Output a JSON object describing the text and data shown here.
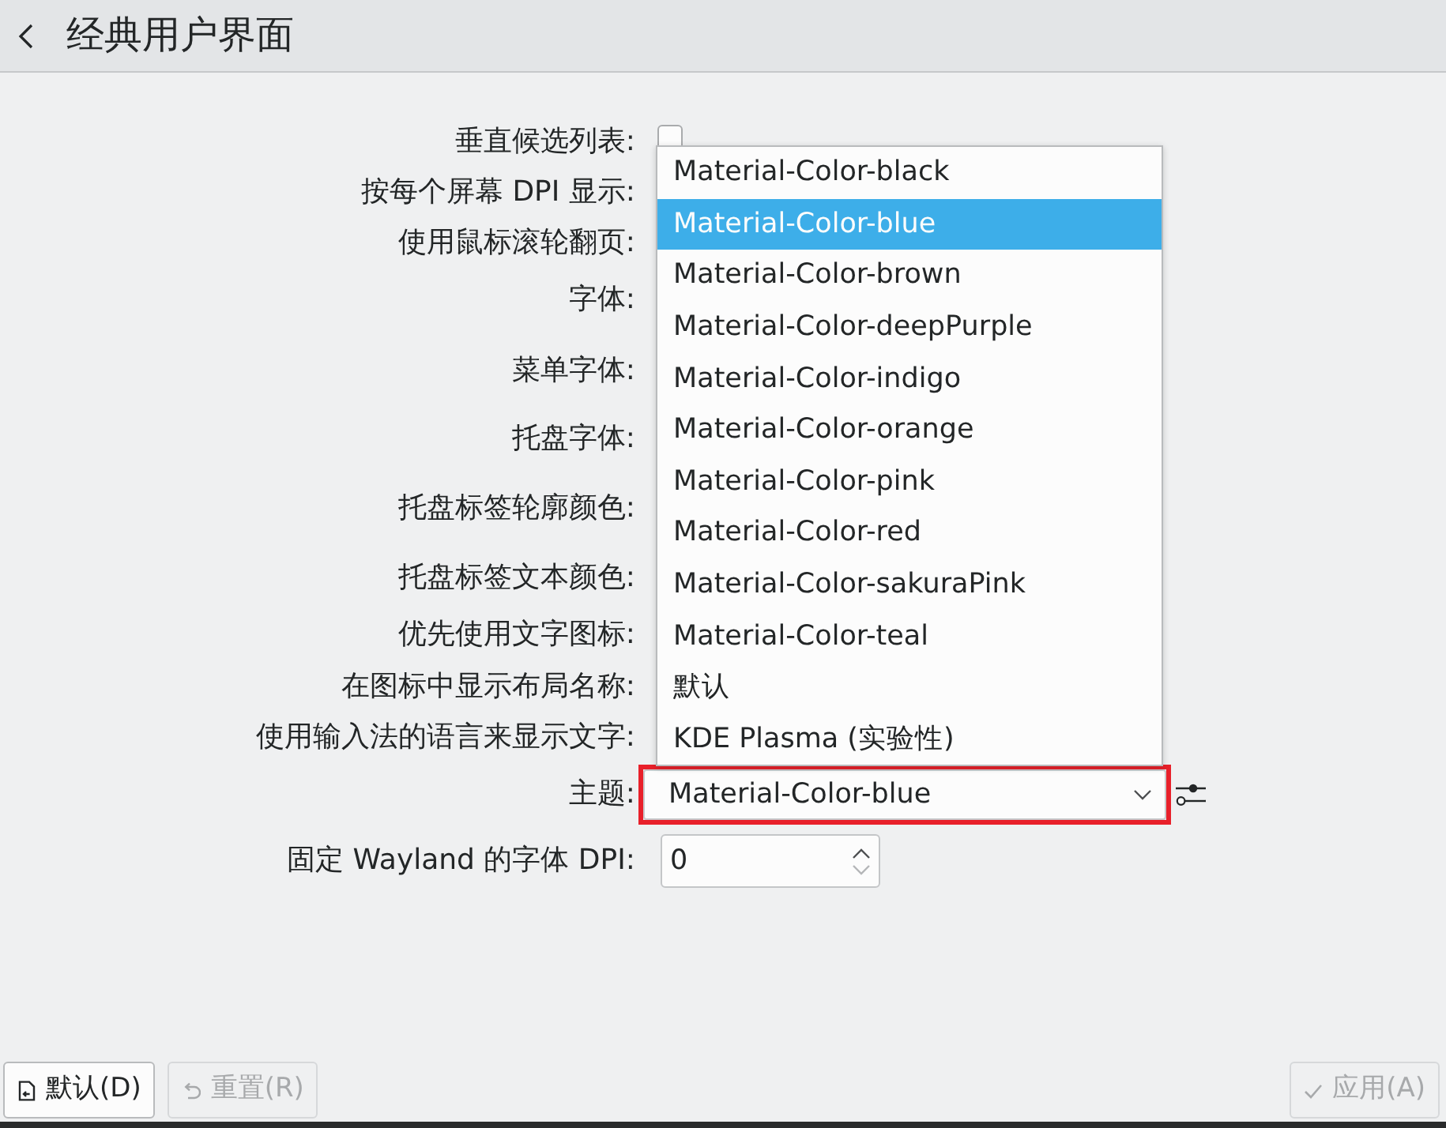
{
  "header": {
    "title": "经典用户界面"
  },
  "form": {
    "rows": [
      {
        "label": "垂直候选列表:",
        "kind": "checkbox",
        "checked": false
      },
      {
        "label": "按每个屏幕 DPI 显示:"
      },
      {
        "label": "使用鼠标滚轮翻页:"
      },
      {
        "label": "字体:"
      },
      {
        "label": "菜单字体:"
      },
      {
        "label": "托盘字体:"
      },
      {
        "label": "托盘标签轮廓颜色:"
      },
      {
        "label": "托盘标签文本颜色:"
      },
      {
        "label": "优先使用文字图标:"
      },
      {
        "label": "在图标中显示布局名称:"
      },
      {
        "label": "使用输入法的语言来显示文字:"
      },
      {
        "label": "主题:",
        "kind": "select",
        "value": "Material-Color-blue",
        "highlighted": true
      },
      {
        "label": "固定 Wayland 的字体 DPI:",
        "kind": "spinbox",
        "value": "0"
      }
    ]
  },
  "theme_dropdown": {
    "options": [
      {
        "label": "Material-Color-black",
        "selected": false
      },
      {
        "label": "Material-Color-blue",
        "selected": true
      },
      {
        "label": "Material-Color-brown",
        "selected": false
      },
      {
        "label": "Material-Color-deepPurple",
        "selected": false
      },
      {
        "label": "Material-Color-indigo",
        "selected": false
      },
      {
        "label": "Material-Color-orange",
        "selected": false
      },
      {
        "label": "Material-Color-pink",
        "selected": false
      },
      {
        "label": "Material-Color-red",
        "selected": false
      },
      {
        "label": "Material-Color-sakuraPink",
        "selected": false
      },
      {
        "label": "Material-Color-teal",
        "selected": false
      },
      {
        "label": "默认",
        "selected": false
      },
      {
        "label": "KDE Plasma (实验性)",
        "selected": false
      }
    ]
  },
  "buttons": [
    {
      "kind": "defaults",
      "label": "默认(D)",
      "disabled": false
    },
    {
      "kind": "reset",
      "label": "重置(R)",
      "disabled": true
    },
    {
      "kind": "apply",
      "label": "应用(A)",
      "disabled": true
    }
  ]
}
